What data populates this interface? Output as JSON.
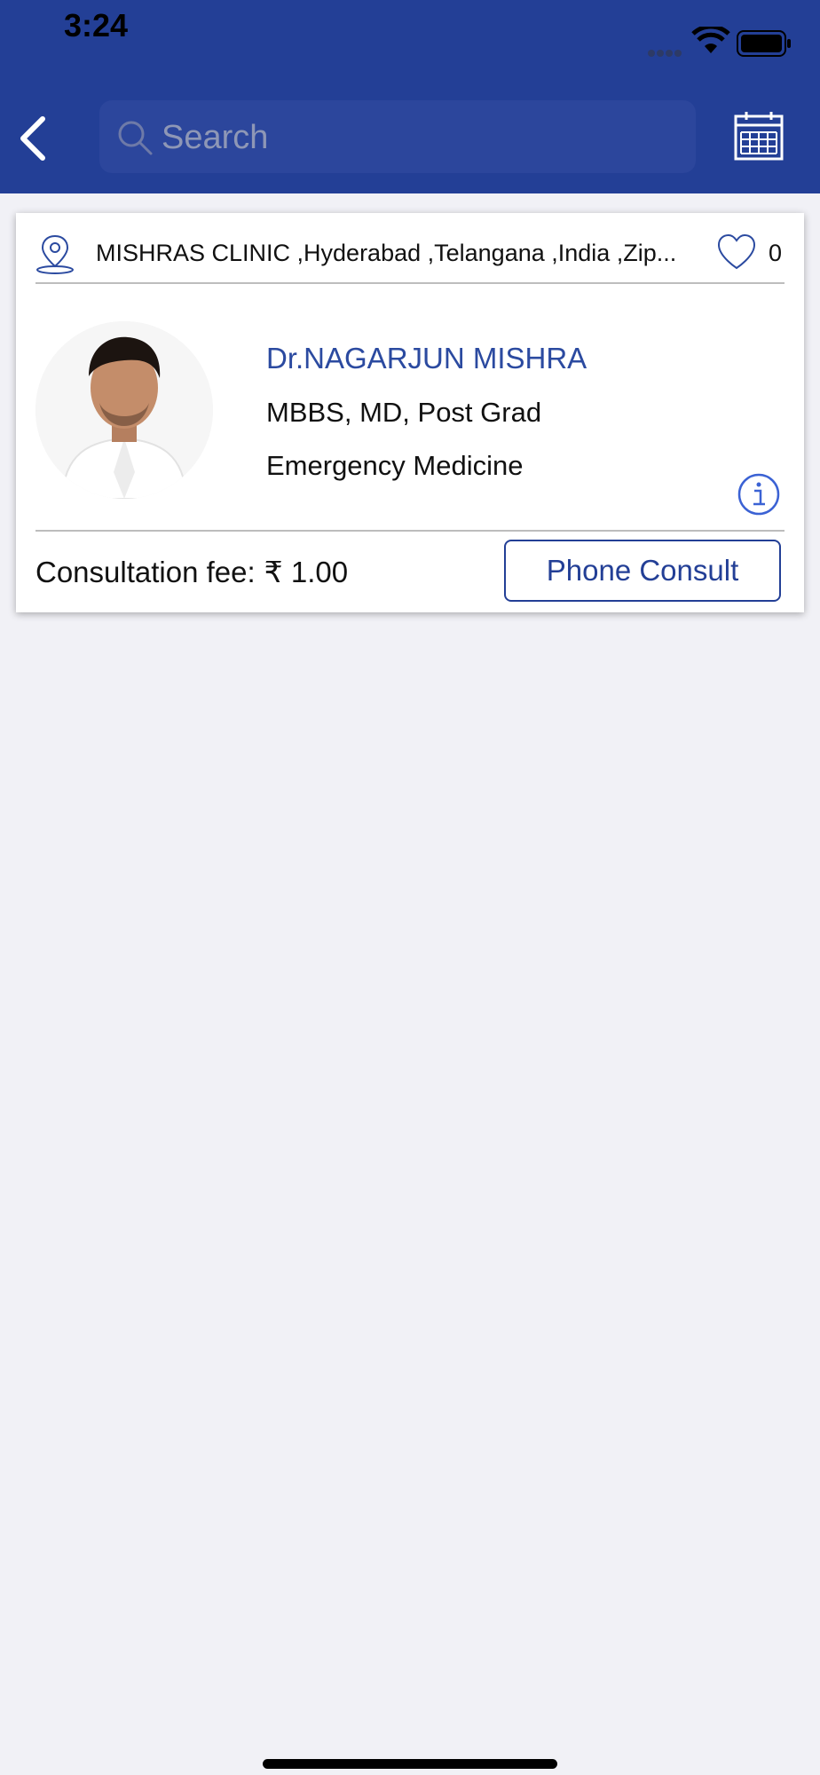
{
  "status_bar": {
    "time": "3:24"
  },
  "header": {
    "search_placeholder": "Search"
  },
  "clinic": {
    "address": "MISHRAS CLINIC ,Hyderabad ,Telangana ,India ,Zip...",
    "likes": "0"
  },
  "doctor": {
    "name": "Dr.NAGARJUN  MISHRA",
    "qualifications": "MBBS, MD, Post Grad",
    "specialty": "Emergency Medicine"
  },
  "consultation": {
    "fee_label": "Consultation fee:",
    "fee_amount": "₹ 1.00",
    "button_label": "Phone Consult"
  },
  "colors": {
    "brand": "#233f96",
    "accent_text": "#2b4aa0",
    "background": "#f1f1f6"
  },
  "icons": [
    "back-chevron-icon",
    "search-icon",
    "calendar-icon",
    "location-pin-icon",
    "heart-icon",
    "info-icon",
    "wifi-icon",
    "battery-icon"
  ]
}
